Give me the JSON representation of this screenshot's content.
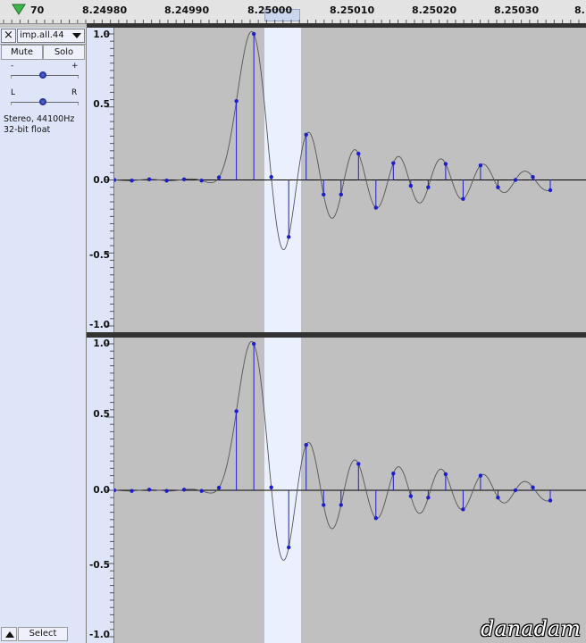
{
  "ruler": {
    "labels": [
      "70",
      "8.24980",
      "8.24990",
      "8.25000",
      "8.25010",
      "8.25020",
      "8.25030",
      "8."
    ]
  },
  "track": {
    "close_label": "×",
    "name": "imp.all.44",
    "mute_label": "Mute",
    "solo_label": "Solo",
    "gain_minus": "-",
    "gain_plus": "+",
    "pan_left": "L",
    "pan_right": "R",
    "info_line1": "Stereo, 44100Hz",
    "info_line2": "32-bit float",
    "select_label": "Select"
  },
  "vertical_ruler": {
    "labels": [
      "1.0",
      "0.5",
      "0.0",
      "-0.5",
      "-1.0"
    ]
  },
  "watermark": "danadam",
  "colors": {
    "waveform_bg": "#c0c0c0",
    "selection": "#eaf0fe",
    "stem": "#1d1dcc",
    "curve": "#555555",
    "panel": "#dfe5f8"
  },
  "waveform": {
    "samples": [
      0.0,
      -0.004,
      0.004,
      -0.004,
      0.004,
      -0.004,
      0.018,
      0.54,
      1.0,
      0.02,
      -0.39,
      0.31,
      -0.1,
      -0.1,
      0.18,
      -0.19,
      0.115,
      -0.04,
      -0.05,
      0.11,
      -0.13,
      0.1,
      -0.05,
      0.0,
      0.02,
      -0.07
    ],
    "sample_time_start": 8.249766,
    "sample_interval": 2.27e-05,
    "time_range": [
      8.249766,
      8.25038
    ],
    "y_range": [
      -1.0,
      1.0
    ]
  }
}
